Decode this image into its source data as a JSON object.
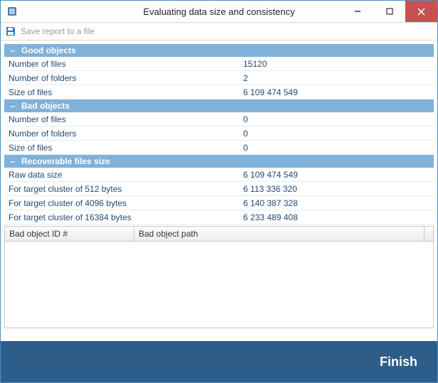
{
  "window": {
    "title": "Evaluating data size and consistency"
  },
  "toolbar": {
    "save_label": "Save report to a file"
  },
  "sections": {
    "good": {
      "title": "Good objects",
      "rows": {
        "files_label": "Number of files",
        "files_value": "15120",
        "folders_label": "Number of folders",
        "folders_value": "2",
        "size_label": "Size of files",
        "size_value": "6 109 474 549"
      }
    },
    "bad": {
      "title": "Bad objects",
      "rows": {
        "files_label": "Number of files",
        "files_value": "0",
        "folders_label": "Number of folders",
        "folders_value": "0",
        "size_label": "Size of files",
        "size_value": "0"
      }
    },
    "recov": {
      "title": "Recoverable files size",
      "rows": {
        "raw_label": "Raw data size",
        "raw_value": "6 109 474 549",
        "c512_label": "For target cluster of 512 bytes",
        "c512_value": "6 113 336 320",
        "c4096_label": "For target cluster of 4096 bytes",
        "c4096_value": "6 140 387 328",
        "c16384_label": "For target cluster of 16384 bytes",
        "c16384_value": "6 233 489 408"
      }
    }
  },
  "table": {
    "col_id": "Bad object ID #",
    "col_path": "Bad object path"
  },
  "footer": {
    "finish_label": "Finish"
  },
  "collapse_glyph": "–"
}
